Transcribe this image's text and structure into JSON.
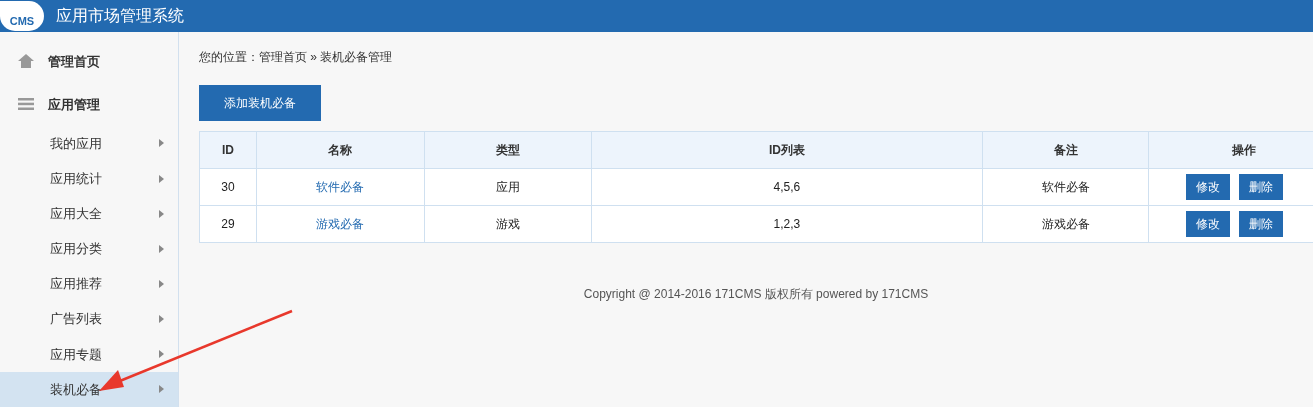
{
  "header": {
    "logo": "CMS",
    "title": "应用市场管理系统"
  },
  "sidebar": {
    "sections": [
      {
        "label": "管理首页",
        "kind": "home"
      },
      {
        "label": "应用管理",
        "kind": "menu",
        "children": [
          {
            "label": "我的应用",
            "selected": false
          },
          {
            "label": "应用统计",
            "selected": false
          },
          {
            "label": "应用大全",
            "selected": false
          },
          {
            "label": "应用分类",
            "selected": false
          },
          {
            "label": "应用推荐",
            "selected": false
          },
          {
            "label": "广告列表",
            "selected": false
          },
          {
            "label": "应用专题",
            "selected": false
          },
          {
            "label": "装机必备",
            "selected": true
          }
        ]
      }
    ]
  },
  "breadcrumb": {
    "prefix": "您的位置：",
    "items": [
      "管理首页",
      "装机必备管理"
    ],
    "separator": "»"
  },
  "add_button": "添加装机必备",
  "table": {
    "columns": [
      "ID",
      "名称",
      "类型",
      "ID列表",
      "备注",
      "操作"
    ],
    "rows": [
      {
        "id": "30",
        "name": "软件必备",
        "type": "应用",
        "ids": "4,5,6",
        "note": "软件必备",
        "actions": [
          "修改",
          "删除"
        ]
      },
      {
        "id": "29",
        "name": "游戏必备",
        "type": "游戏",
        "ids": "1,2,3",
        "note": "游戏必备",
        "actions": [
          "修改",
          "删除"
        ]
      }
    ]
  },
  "footer": "Copyright @ 2014-2016 171CMS 版权所有 powered by 171CMS"
}
